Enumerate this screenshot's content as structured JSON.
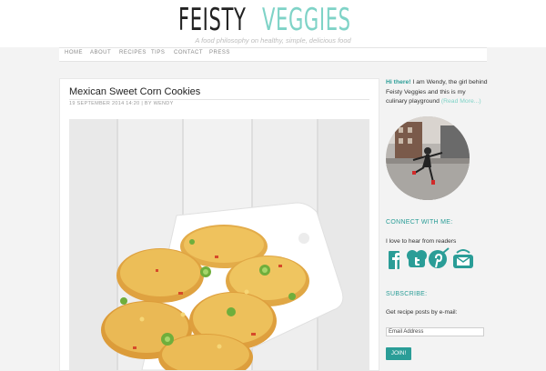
{
  "site": {
    "logo_part1": "FEISTY",
    "logo_part2": "VEGGIES",
    "tagline": "A food philosophy on healthy, simple, delicious food"
  },
  "nav": [
    "HOME",
    "ABOUT",
    "RECIPES",
    "TIPS",
    "CONTACT",
    "PRESS"
  ],
  "post": {
    "title": "Mexican Sweet Corn Cookies",
    "meta": "19 SEPTEMBER 2014 14:20  |  BY WENDY"
  },
  "sidebar": {
    "intro_hi": "Hi there!",
    "intro_text": " I am Wendy, the girl behind Feisty Veggies and this is my culinary playground ",
    "intro_more": "(Read More...)",
    "connect_title": "CONNECT WITH ME:",
    "connect_text": "I love to hear from readers",
    "social_icons": [
      "facebook-icon",
      "twitter-icon",
      "pinterest-icon",
      "email-icon"
    ],
    "subscribe_title": "SUBSCRIBE:",
    "subscribe_text": "Get recipe posts by e-mail:",
    "email_placeholder": "Email Address",
    "join_label": "JOIN!"
  },
  "colors": {
    "accent": "#2a9d97",
    "logo_mint": "#7fd3c7"
  }
}
